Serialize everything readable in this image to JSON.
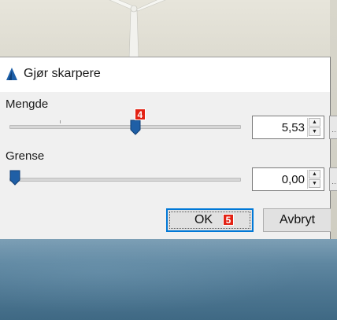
{
  "dialog": {
    "title": "Gjør skarpere",
    "amount": {
      "label": "Mengde",
      "value": "5,53",
      "slider_level": 0.55
    },
    "threshold": {
      "label": "Grense",
      "value": "0,00",
      "slider_level": 0.0
    },
    "ok_label": "OK",
    "cancel_label": "Avbryt"
  },
  "annotations": {
    "slider_badge": "4",
    "ok_badge": "5"
  },
  "icons": {
    "title": "sharpen-triangle-icon",
    "spin_up": "spin-up-arrow-icon",
    "spin_down": "spin-down-arrow-icon",
    "slider_thumb": "slider-thumb-icon"
  },
  "colors": {
    "accent": "#0078d7",
    "thumb": "#1f5fa6",
    "badge": "#e32214"
  }
}
